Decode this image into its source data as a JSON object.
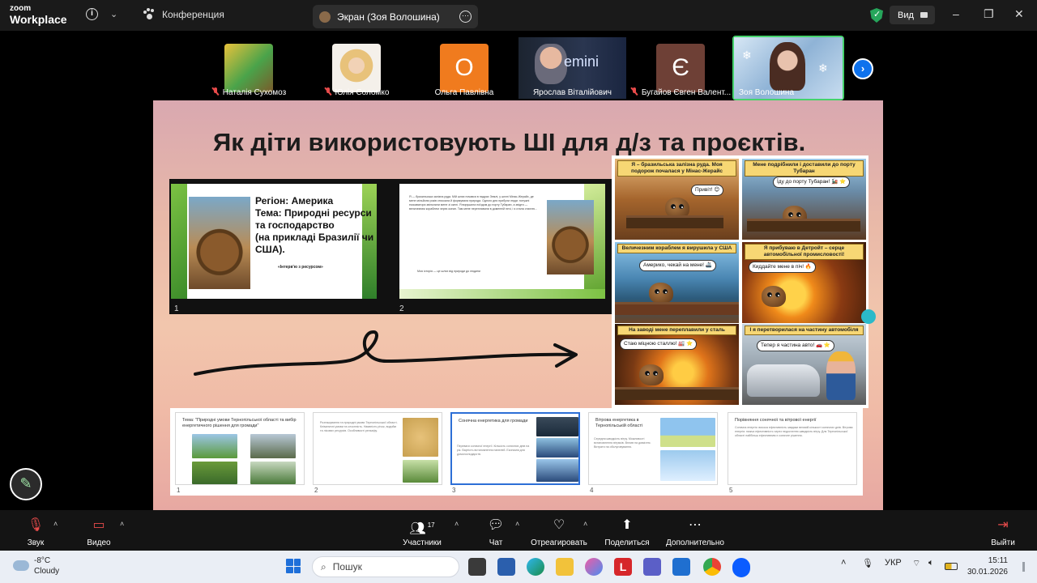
{
  "titlebar": {
    "logo_top": "zoom",
    "logo_bottom": "Workplace",
    "conference_tab": "Конференция",
    "screen_tab": "Экран (Зоя Волошина)",
    "view_label": "Вид",
    "window_controls": [
      "–",
      "❐",
      "✕"
    ]
  },
  "participants": [
    {
      "name": "Наталія Сухомоз",
      "muted": true,
      "avatar": "photo",
      "color": "#c9a227"
    },
    {
      "name": "Юлія Соломко",
      "muted": true,
      "avatar": "photo",
      "color": "#e7c28a"
    },
    {
      "name": "Ольга Павлівна",
      "muted": false,
      "avatar": "О",
      "color": "#f07b1e"
    },
    {
      "name": "Ярослав Віталійович",
      "muted": false,
      "avatar": "video",
      "color": "#3a3a3a"
    },
    {
      "name": "Бугайов Євген Валент...",
      "muted": true,
      "avatar": "Є",
      "color": "#6e4036"
    },
    {
      "name": "Зоя Волошина",
      "muted": false,
      "avatar": "video",
      "color": "#7a9fc6",
      "active": true
    }
  ],
  "gemini_text": "emini",
  "slide": {
    "title": "Як діти використовують ШІ для д/з та проєктів.",
    "mini1": {
      "heading": "Регіон: Америка\nТема: Природні ресурси\nта господарство\n (на прикладі Бразилії чи\nСША).",
      "sub": "«Інтерв'ю з ресурсом»",
      "num": "1"
    },
    "mini2": {
      "body": "Я — бразильська залізна руда. Мій шлях почався в надрах Землі, у штаті Мінас-Жерайс, де мене мільйони років стискала й формувала природа. Одного дня прибули люди: потужні екскаватори звільнили мене зі скелі. Я вирушила поїздом до порту Тубаран, а звідти — величезним кораблем через океан. Там мене переплавили в доменній печі, і я стала сталлю...",
      "foot": "Моя історія — це шлях від природи до людини",
      "num": "2"
    },
    "comic": [
      {
        "caption": "Я – бразильська залізна руда. Моя подорож почалася у Мінас-Жерайс",
        "bubble": "Привіт! 😊"
      },
      {
        "caption": "Мене подрібнили і доставили до порту Тубаран",
        "bubble": "Їду до порту Тубаран! 🚂 ⭐"
      },
      {
        "caption": "Величезним кораблем я вирушила у США",
        "bubble": "Америко, чекай на мене! 🚢"
      },
      {
        "caption": "Я прибуваю в Детройт – серце автомобільної промисловості!",
        "bubble": "Киддайте мене в піч! 🔥"
      },
      {
        "caption": "На заводі мене переплавили у сталь",
        "bubble": "Стаю міцною сталлю! 🏭 ⭐"
      },
      {
        "caption": "І я перетворилася на частину автомобіля",
        "bubble": "Тепер я частина авто! 🚗 ⭐"
      }
    ],
    "thumbs": [
      {
        "num": "1",
        "title": "Тема: \"Природні умови Тернопільської області та вибір енергетичного рішення для громади\"",
        "lines": ""
      },
      {
        "num": "2",
        "title": "",
        "lines": "Розташування та природні умови Тернопільської області. Кліматичні умови та сезонність. Наявність річок, водойм та лісових ресурсів. Особливості рельєфу."
      },
      {
        "num": "3",
        "title": "Сонячна енергетика для громади",
        "lines": "Переваги сонячної енергії. Кількість сонячних днів на рік. Вартість встановлення панелей. Економія для домогосподарств."
      },
      {
        "num": "4",
        "title": "Вітрова енергетика в Тернопільській області",
        "lines": "Середня швидкість вітру. Можливості встановлення вітряків. Вплив на довкілля. Витрати на обслуговування."
      },
      {
        "num": "5",
        "title": "Порівняння сонячної та вітрової енергії",
        "lines": "Сонячна енергія: висока ефективність завдяки великій кількості сонячних днів. Вітрова енергія: нижча ефективність через недостатню швидкість вітру. Для Тернопільської області найбільш ефективним є сонячне рішення."
      }
    ]
  },
  "toolbar": {
    "audio": "Звук",
    "video": "Видео",
    "participants": "Участники",
    "participants_count": "17",
    "chat": "Чат",
    "react": "Отреагировать",
    "share": "Поделиться",
    "more": "Дополнительно",
    "leave": "Выйти"
  },
  "taskbar": {
    "temp": "-8°C",
    "weather": "Cloudy",
    "search_placeholder": "Пошук",
    "lang": "УКР",
    "time": "15:11",
    "date": "30.01.2026"
  },
  "colors": {
    "accent": "#0e72ed",
    "active_speaker": "#45d26b",
    "muted": "#e84b4b",
    "selected_thumb": "#2d6fd6"
  }
}
